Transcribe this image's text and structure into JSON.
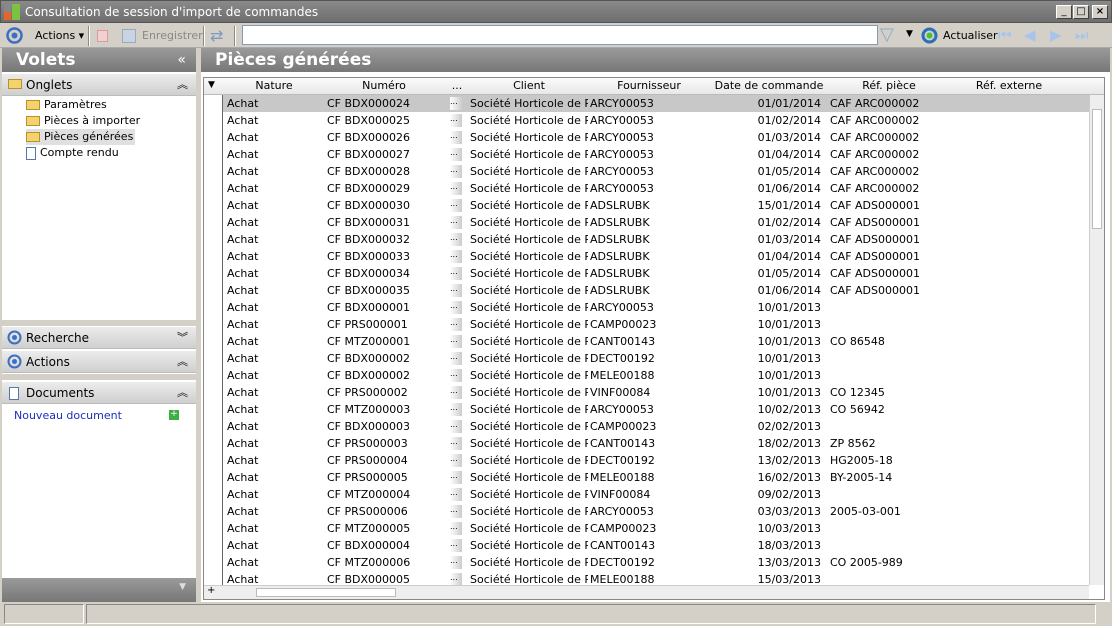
{
  "window": {
    "title": "Consultation de session d'import de commandes",
    "minimize": "_",
    "maximize": "□",
    "close": "×"
  },
  "toolbar": {
    "actions": "Actions ▾",
    "save": "Enregistrer",
    "search_value": "",
    "refresh": "Actualiser"
  },
  "left": {
    "title": "Volets",
    "collapse": "«",
    "onglets": {
      "label": "Onglets",
      "items": [
        "Paramètres",
        "Pièces à importer",
        "Pièces générées",
        "Compte rendu"
      ],
      "selected": 2
    },
    "recherche": "Recherche",
    "actions": "Actions",
    "documents": "Documents",
    "new_doc": "Nouveau document"
  },
  "main": {
    "title": "Pièces générées"
  },
  "grid": {
    "columns": [
      "Nature",
      "Numéro",
      "...",
      "Client",
      "Fournisseur",
      "Date de commande",
      "Réf. pièce",
      "Réf. externe"
    ],
    "rows": [
      [
        "Achat",
        "CF BDX000024",
        "Société Horticole de Par",
        "ARCY00053",
        "01/01/2014",
        "CAF ARC000002",
        ""
      ],
      [
        "Achat",
        "CF BDX000025",
        "Société Horticole de Par",
        "ARCY00053",
        "01/02/2014",
        "CAF ARC000002",
        ""
      ],
      [
        "Achat",
        "CF BDX000026",
        "Société Horticole de Par",
        "ARCY00053",
        "01/03/2014",
        "CAF ARC000002",
        ""
      ],
      [
        "Achat",
        "CF BDX000027",
        "Société Horticole de Par",
        "ARCY00053",
        "01/04/2014",
        "CAF ARC000002",
        ""
      ],
      [
        "Achat",
        "CF BDX000028",
        "Société Horticole de Par",
        "ARCY00053",
        "01/05/2014",
        "CAF ARC000002",
        ""
      ],
      [
        "Achat",
        "CF BDX000029",
        "Société Horticole de Par",
        "ARCY00053",
        "01/06/2014",
        "CAF ARC000002",
        ""
      ],
      [
        "Achat",
        "CF BDX000030",
        "Société Horticole de Par",
        "ADSLRUBK",
        "15/01/2014",
        "CAF ADS000001",
        ""
      ],
      [
        "Achat",
        "CF BDX000031",
        "Société Horticole de Par",
        "ADSLRUBK",
        "01/02/2014",
        "CAF ADS000001",
        ""
      ],
      [
        "Achat",
        "CF BDX000032",
        "Société Horticole de Par",
        "ADSLRUBK",
        "01/03/2014",
        "CAF ADS000001",
        ""
      ],
      [
        "Achat",
        "CF BDX000033",
        "Société Horticole de Par",
        "ADSLRUBK",
        "01/04/2014",
        "CAF ADS000001",
        ""
      ],
      [
        "Achat",
        "CF BDX000034",
        "Société Horticole de Par",
        "ADSLRUBK",
        "01/05/2014",
        "CAF ADS000001",
        ""
      ],
      [
        "Achat",
        "CF BDX000035",
        "Société Horticole de Par",
        "ADSLRUBK",
        "01/06/2014",
        "CAF ADS000001",
        ""
      ],
      [
        "Achat",
        "CF BDX000001",
        "Société Horticole de Par",
        "ARCY00053",
        "10/01/2013",
        "",
        ""
      ],
      [
        "Achat",
        "CF PRS000001",
        "Société Horticole de Par",
        "CAMP00023",
        "10/01/2013",
        "",
        ""
      ],
      [
        "Achat",
        "CF MTZ000001",
        "Société Horticole de Par",
        "CANT00143",
        "10/01/2013",
        "CO 86548",
        ""
      ],
      [
        "Achat",
        "CF BDX000002",
        "Société Horticole de Par",
        "DECT00192",
        "10/01/2013",
        "",
        ""
      ],
      [
        "Achat",
        "CF BDX000002",
        "Société Horticole de Par",
        "MELE00188",
        "10/01/2013",
        "",
        ""
      ],
      [
        "Achat",
        "CF PRS000002",
        "Société Horticole de Par",
        "VINF00084",
        "10/01/2013",
        "CO 12345",
        ""
      ],
      [
        "Achat",
        "CF MTZ000003",
        "Société Horticole de Par",
        "ARCY00053",
        "10/02/2013",
        "CO 56942",
        ""
      ],
      [
        "Achat",
        "CF BDX000003",
        "Société Horticole de Par",
        "CAMP00023",
        "02/02/2013",
        "",
        ""
      ],
      [
        "Achat",
        "CF PRS000003",
        "Société Horticole de Par",
        "CANT00143",
        "18/02/2013",
        "ZP 8562",
        ""
      ],
      [
        "Achat",
        "CF PRS000004",
        "Société Horticole de Par",
        "DECT00192",
        "13/02/2013",
        "HG2005-18",
        ""
      ],
      [
        "Achat",
        "CF PRS000005",
        "Société Horticole de Par",
        "MELE00188",
        "16/02/2013",
        "BY-2005-14",
        ""
      ],
      [
        "Achat",
        "CF MTZ000004",
        "Société Horticole de Par",
        "VINF00084",
        "09/02/2013",
        "",
        ""
      ],
      [
        "Achat",
        "CF PRS000006",
        "Société Horticole de Par",
        "ARCY00053",
        "03/03/2013",
        "2005-03-001",
        ""
      ],
      [
        "Achat",
        "CF MTZ000005",
        "Société Horticole de Par",
        "CAMP00023",
        "10/03/2013",
        "",
        ""
      ],
      [
        "Achat",
        "CF BDX000004",
        "Société Horticole de Par",
        "CANT00143",
        "18/03/2013",
        "",
        ""
      ],
      [
        "Achat",
        "CF MTZ000006",
        "Société Horticole de Par",
        "DECT00192",
        "13/03/2013",
        "CO 2005-989",
        ""
      ],
      [
        "Achat",
        "CF BDX000005",
        "Société Horticole de Par",
        "MELE00188",
        "15/03/2013",
        "",
        ""
      ]
    ],
    "selected_row": 0,
    "dots_cell": "..."
  }
}
